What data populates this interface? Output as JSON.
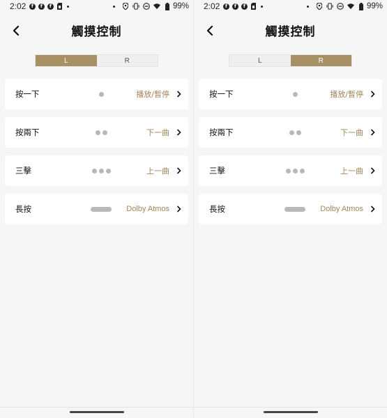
{
  "status_bar": {
    "time": "2:02",
    "left_icons": [
      "facebook-icon",
      "facebook-icon",
      "facebook-icon",
      "sim-icon"
    ],
    "right_icons": [
      "location-icon",
      "vibrate-icon",
      "dnd-icon",
      "wifi-icon",
      "battery-icon"
    ],
    "battery": "99%"
  },
  "header": {
    "title": "觸摸控制"
  },
  "segment": {
    "left_label": "L",
    "right_label": "R"
  },
  "rows": [
    {
      "label": "按一下",
      "gesture": "single-tap",
      "value": "播放/暫停"
    },
    {
      "label": "按兩下",
      "gesture": "double-tap",
      "value": "下一曲"
    },
    {
      "label": "三擊",
      "gesture": "triple-tap",
      "value": "上一曲"
    },
    {
      "label": "長按",
      "gesture": "long-press",
      "value": "Dolby Atmos"
    }
  ],
  "screens": [
    {
      "side": "left",
      "selected": "L"
    },
    {
      "side": "right",
      "selected": "R"
    }
  ],
  "colors": {
    "accent": "#a69064",
    "value_text": "#a08659",
    "background": "#f6f6f6",
    "row_bg": "#ffffff",
    "gesture_gray": "#b8b8b8"
  }
}
